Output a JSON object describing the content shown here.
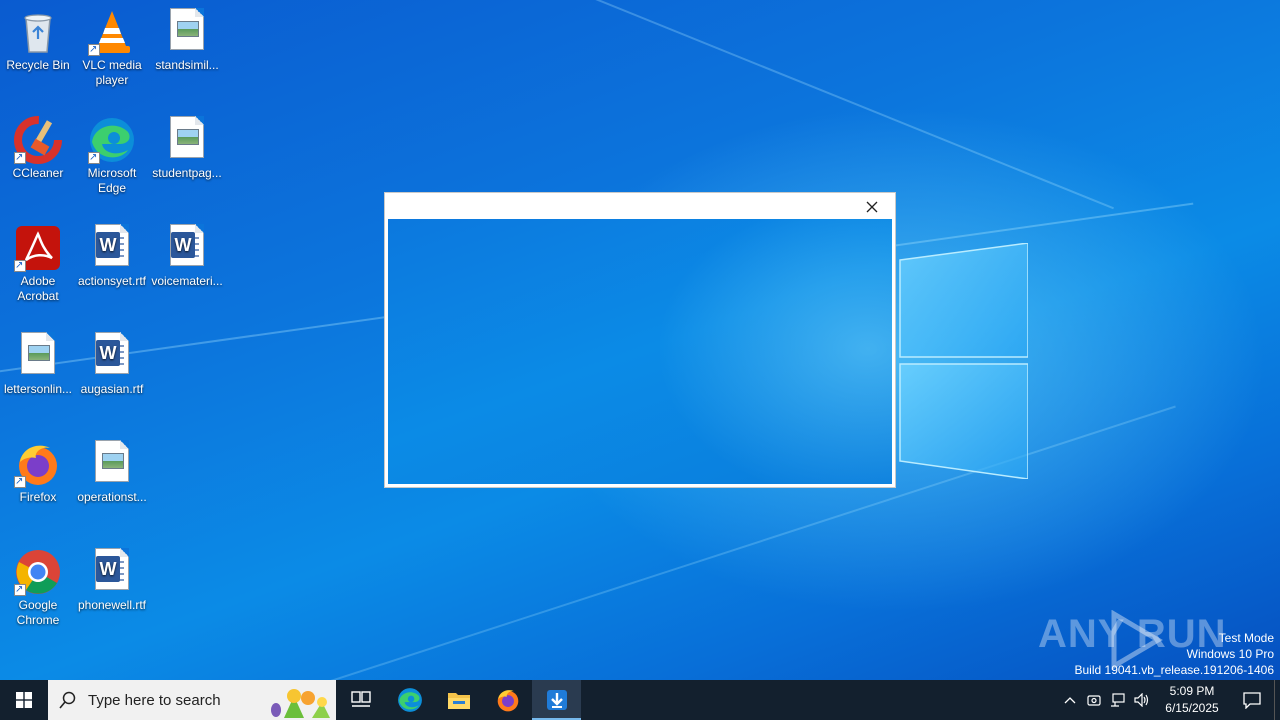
{
  "desktop": {
    "icons": [
      {
        "label": "Recycle Bin",
        "icon": "recycle-bin-icon"
      },
      {
        "label": "VLC media player",
        "icon": "vlc-icon"
      },
      {
        "label": "standsimil...",
        "icon": "image-file-icon"
      },
      {
        "label": "CCleaner",
        "icon": "ccleaner-icon"
      },
      {
        "label": "Microsoft Edge",
        "icon": "edge-icon"
      },
      {
        "label": "studentpag...",
        "icon": "image-file-icon"
      },
      {
        "label": "Adobe Acrobat",
        "icon": "acrobat-icon"
      },
      {
        "label": "actionsyet.rtf",
        "icon": "word-document-icon"
      },
      {
        "label": "voicemateri...",
        "icon": "word-document-icon"
      },
      {
        "label": "lettersonlin...",
        "icon": "image-file-icon"
      },
      {
        "label": "augasian.rtf",
        "icon": "word-document-icon"
      },
      {
        "label": "Firefox",
        "icon": "firefox-icon"
      },
      {
        "label": "operationst...",
        "icon": "image-file-icon"
      },
      {
        "label": "Google Chrome",
        "icon": "chrome-icon"
      },
      {
        "label": "phonewell.rtf",
        "icon": "word-document-icon"
      }
    ]
  },
  "dialog": {
    "close_icon": "close-icon"
  },
  "watermark": {
    "brand": "ANY RUN",
    "line1": "Test Mode",
    "line2": "Windows 10 Pro",
    "line3": "Build 19041.vb_release.191206-1406"
  },
  "taskbar": {
    "search_placeholder": "Type here to search",
    "apps": [
      "task-view-icon",
      "edge-icon",
      "file-explorer-icon",
      "firefox-icon",
      "download-installer-icon"
    ],
    "clock_time": "5:09 PM",
    "clock_date": "6/15/2025"
  },
  "colors": {
    "taskbar": "#13202e",
    "desktop_accent": "#0b74da"
  }
}
